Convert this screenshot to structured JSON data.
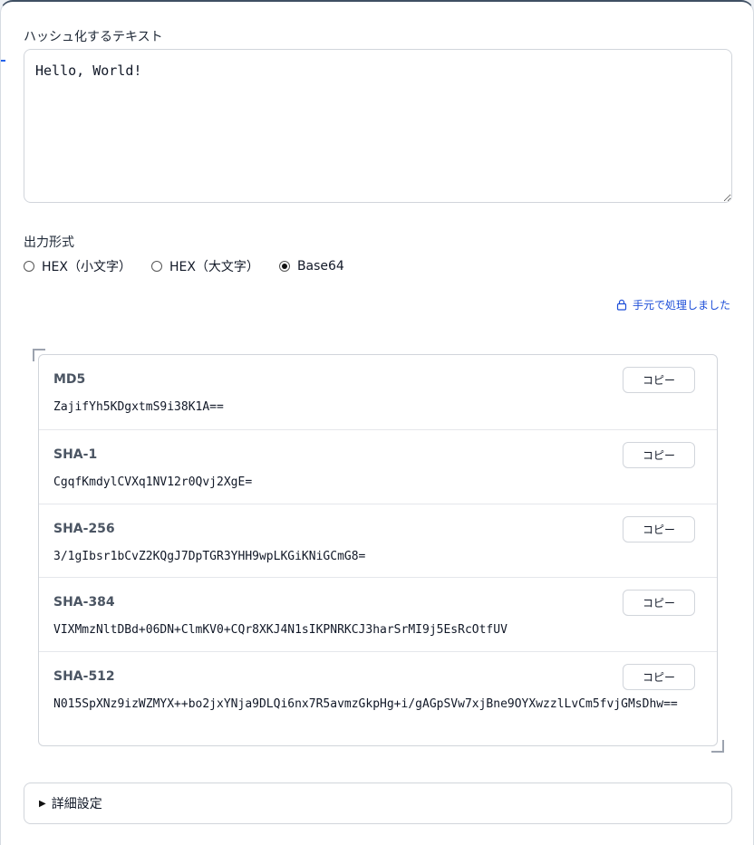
{
  "input": {
    "label": "ハッシュ化するテキスト",
    "value": "Hello, World!"
  },
  "format": {
    "label": "出力形式",
    "options": [
      {
        "label": "HEX（小文字）",
        "selected": false
      },
      {
        "label": "HEX（大文字）",
        "selected": false
      },
      {
        "label": "Base64",
        "selected": true
      }
    ]
  },
  "local_note": "手元で処理しました",
  "copy_label": "コピー",
  "results": [
    {
      "algorithm": "MD5",
      "hash": "ZajifYh5KDgxtmS9i38K1A=="
    },
    {
      "algorithm": "SHA-1",
      "hash": "CgqfKmdylCVXq1NV12r0Qvj2XgE="
    },
    {
      "algorithm": "SHA-256",
      "hash": "3/1gIbsr1bCvZ2KQgJ7DpTGR3YHH9wpLKGiKNiGCmG8="
    },
    {
      "algorithm": "SHA-384",
      "hash": "VIXMmzNltDBd+06DN+ClmKV0+CQr8XKJ4N1sIKPNRKCJ3harSrMI9j5EsRcOtfUV"
    },
    {
      "algorithm": "SHA-512",
      "hash": "N015SpXNz9izWZMYX++bo2jxYNja9DLQi6nx7R5avmzGkpHg+i/gAGpSVw7xjBne9OYXwzzlLvCm5fvjGMsDhw=="
    }
  ],
  "details": {
    "label": "詳細設定"
  },
  "colors": {
    "accent": "#1d4ed8",
    "card_border_top": "#3f4f63"
  }
}
